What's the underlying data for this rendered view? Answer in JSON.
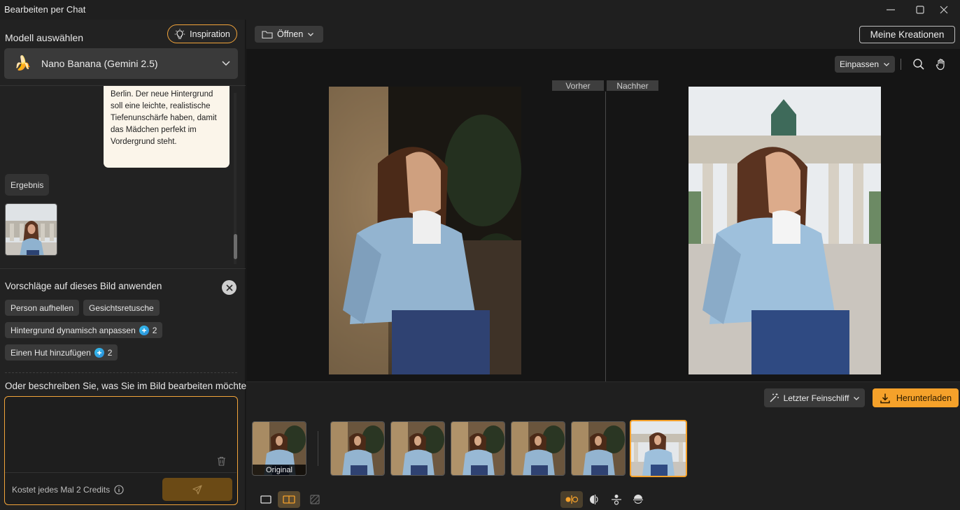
{
  "window": {
    "title": "Bearbeiten per Chat"
  },
  "left": {
    "model_label": "Modell auswählen",
    "inspiration_label": "Inspiration",
    "model_name": "Nano Banana (Gemini 2.5)",
    "chat_message_lines": [
      "Berlin. Der neue Hintergrund",
      "soll eine leichte, realistische",
      "Tiefenunschärfe haben, damit",
      "das Mädchen perfekt im",
      "Vordergrund steht."
    ],
    "result_label": "Ergebnis",
    "suggestions_title": "Vorschläge auf dieses Bild anwenden",
    "suggestions": [
      {
        "label": "Person aufhellen",
        "credits": ""
      },
      {
        "label": "Gesichtsretusche",
        "credits": ""
      },
      {
        "label": "Hintergrund dynamisch anpassen",
        "credits": "2"
      },
      {
        "label": "Einen Hut hinzufügen",
        "credits": "2"
      }
    ],
    "describe_label": "Oder beschreiben Sie, was Sie im Bild bearbeiten möchten",
    "input_value": "",
    "cost_text": "Kostet jedes Mal 2 Credits"
  },
  "toolbar": {
    "open_label": "Öffnen",
    "my_creations_label": "Meine Kreationen",
    "fit_label": "Einpassen"
  },
  "compare": {
    "before_label": "Vorher",
    "after_label": "Nachher"
  },
  "actions": {
    "polish_label": "Letzter Feinschliff",
    "download_label": "Herunterladen"
  },
  "filmstrip": {
    "original_caption": "Original",
    "selected_index": 6
  },
  "colors": {
    "accent": "#f5a12a",
    "panel": "#222222",
    "canvas": "#151515"
  },
  "icons": [
    "banana-icon",
    "lightbulb-icon",
    "chevron-down-icon",
    "folder-icon",
    "search-icon",
    "hand-icon",
    "close-icon",
    "trash-icon",
    "info-icon",
    "send-icon",
    "magic-wand-icon",
    "download-icon"
  ]
}
